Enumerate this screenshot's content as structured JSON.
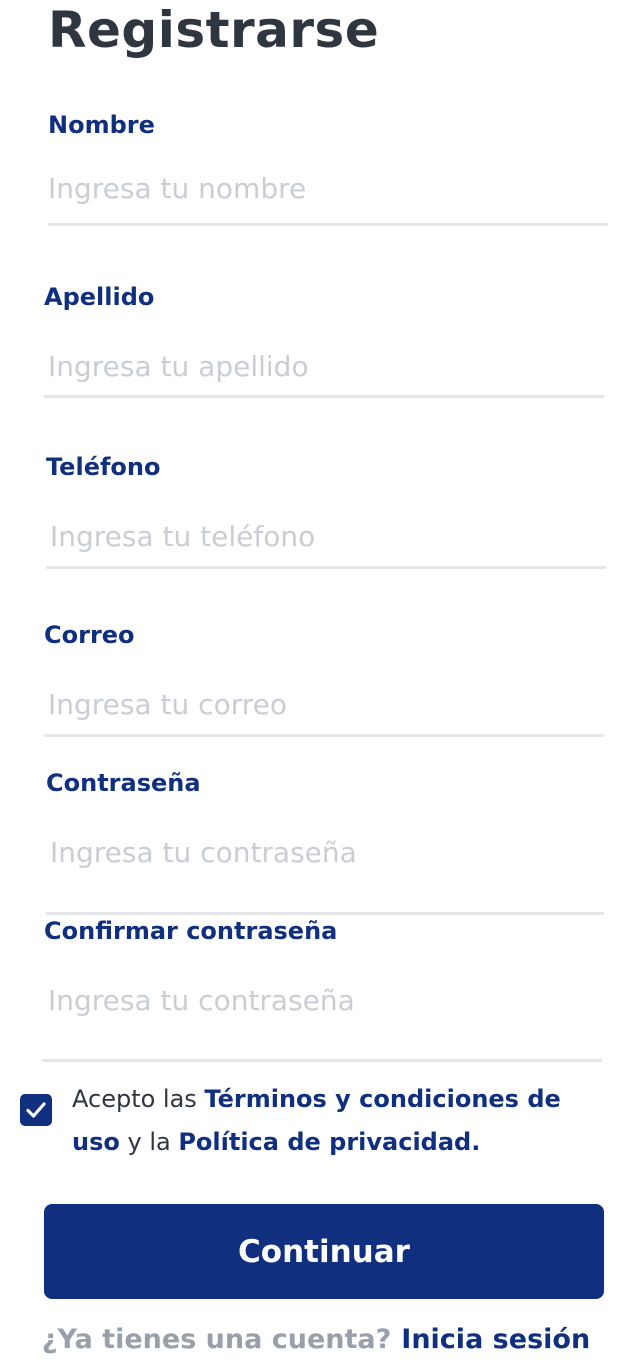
{
  "page": {
    "title": "Registrarse"
  },
  "form": {
    "nombre": {
      "label": "Nombre",
      "placeholder": "Ingresa tu nombre",
      "value": ""
    },
    "apellido": {
      "label": "Apellido",
      "placeholder": "Ingresa tu apellido",
      "value": ""
    },
    "telefono": {
      "label": "Teléfono",
      "placeholder": "Ingresa tu teléfono",
      "value": ""
    },
    "correo": {
      "label": "Correo",
      "placeholder": "Ingresa tu correo",
      "value": ""
    },
    "contrasena": {
      "label": "Contraseña",
      "placeholder": "Ingresa tu contraseña",
      "value": ""
    },
    "confirmar": {
      "label": "Confirmar contraseña",
      "placeholder": "Ingresa tu contraseña",
      "value": ""
    }
  },
  "terms": {
    "checked": true,
    "text_1": "Acepto las ",
    "terms_link": "Términos y condiciones de uso",
    "text_2": " y la ",
    "privacy_link": "Política de privacidad."
  },
  "actions": {
    "continue_label": "Continuar"
  },
  "footer": {
    "question": "¿Ya tienes una cuenta?",
    "login_link": "Inicia sesión"
  },
  "colors": {
    "primary": "#10307f",
    "title": "#2f3640",
    "placeholder": "#c9cdd4",
    "divider": "#e4e6ea",
    "muted": "#9aa0aa"
  },
  "icons": {
    "checkbox": "checkmark-icon"
  }
}
